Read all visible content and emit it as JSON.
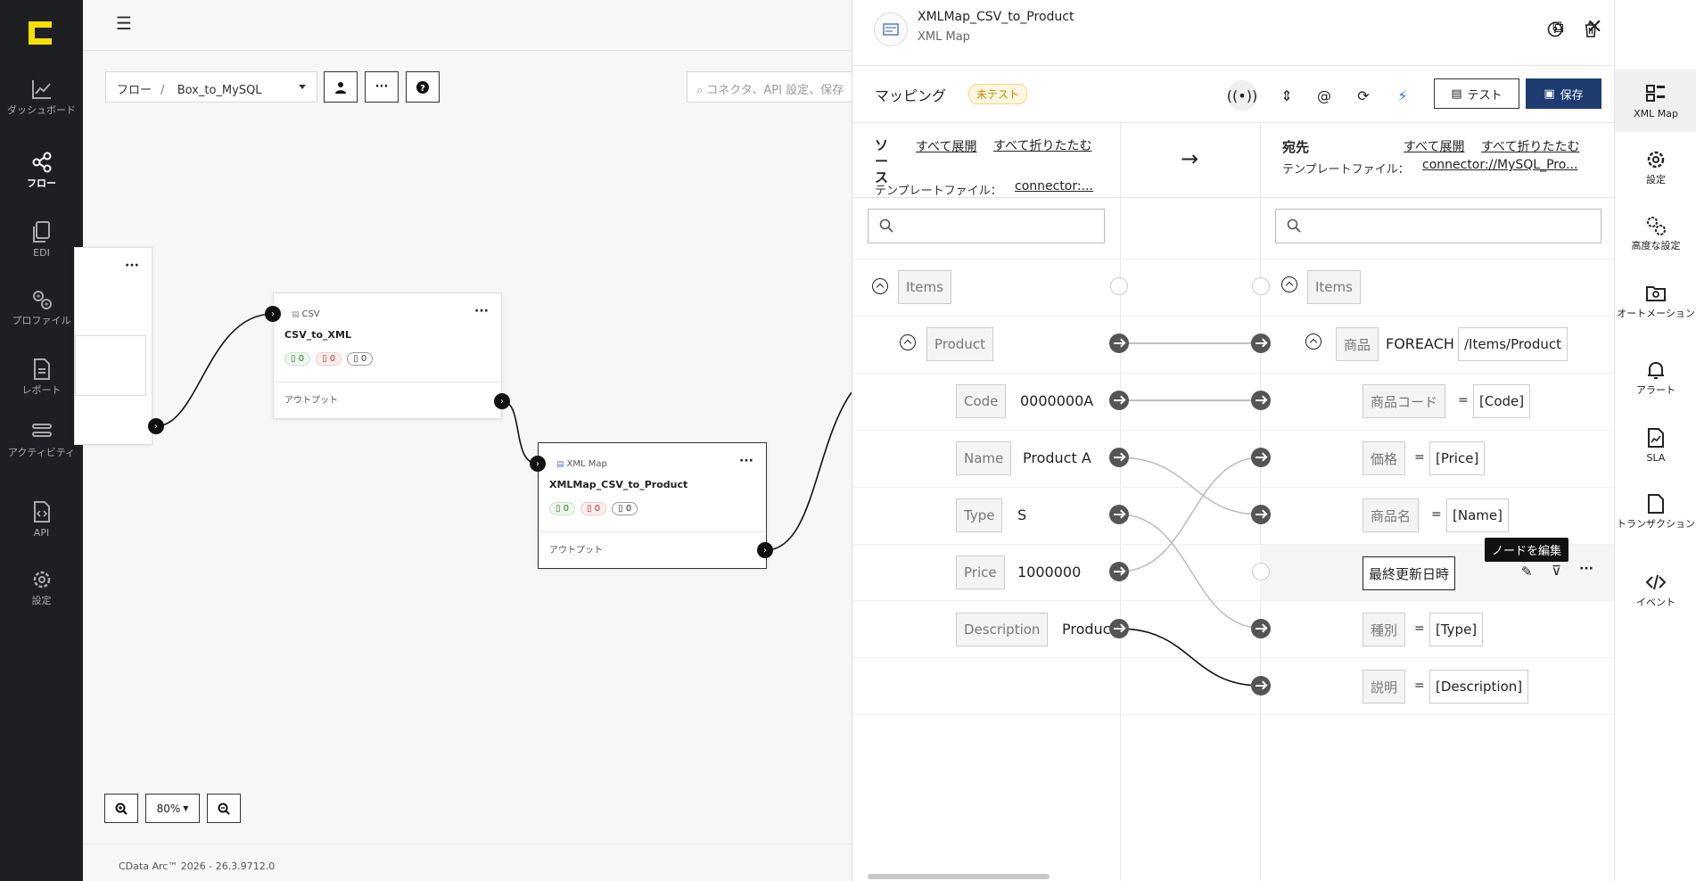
{
  "leftnav": {
    "items": [
      {
        "label": "ダッシュボード",
        "icon": "chart-line-icon"
      },
      {
        "label": "フロー",
        "icon": "share-nodes-icon"
      },
      {
        "label": "EDI",
        "icon": "copy-icon"
      },
      {
        "label": "プロファイル",
        "icon": "gears-icon"
      },
      {
        "label": "レポート",
        "icon": "file-lines-icon"
      },
      {
        "label": "アクティビティ",
        "icon": "layers-icon"
      },
      {
        "label": "API",
        "icon": "file-code-icon"
      },
      {
        "label": "設定",
        "icon": "gear-icon"
      }
    ]
  },
  "canvas": {
    "breadcrumb_root": "フロー",
    "breadcrumb_sep": "/",
    "breadcrumb_current": "Box_to_MySQL",
    "search_placeholder": "コネクタ、API 設定、保存",
    "zoom": "80%",
    "footer": "CData Arc™ 2026 - 26.3.9712.0",
    "nodes": [
      {
        "type": "CSV",
        "title": "CSV_to_XML",
        "ok": "0",
        "err": "0",
        "pending": "0",
        "out": "アウトプット"
      },
      {
        "type": "XML Map",
        "title": "XMLMap_CSV_to_Product",
        "ok": "0",
        "err": "0",
        "pending": "0",
        "out": "アウトプット"
      }
    ]
  },
  "panel": {
    "title": "XMLMap_CSV_to_Product",
    "subtitle": "XML Map",
    "tab_title": "マッピング",
    "badge": "未テスト",
    "test_label": "テスト",
    "save_label": "保存",
    "source": {
      "label": "ソース",
      "expand_all": "すべて展開",
      "collapse_all": "すべて折りたたむ",
      "template_label": "テンプレートファイル：",
      "template_value": "connector:..."
    },
    "arrow": "→",
    "dest": {
      "label": "宛先",
      "expand_all": "すべて展開",
      "collapse_all": "すべて折りたたむ",
      "template_label": "テンプレートファイル：",
      "template_value": "connector://MySQL_Pro..."
    },
    "source_rows": [
      {
        "name": "Items",
        "value": ""
      },
      {
        "name": "Product",
        "value": ""
      },
      {
        "name": "Code",
        "value": "0000000A"
      },
      {
        "name": "Name",
        "value": "Product A"
      },
      {
        "name": "Type",
        "value": "S"
      },
      {
        "name": "Price",
        "value": "1000000"
      },
      {
        "name": "Description",
        "value": "Produc"
      }
    ],
    "dest_rows": [
      {
        "name": "Items",
        "op": "",
        "expr": ""
      },
      {
        "name": "商品",
        "op": "FOREACH",
        "expr": "/Items/Product"
      },
      {
        "name": "商品コード",
        "op": "=",
        "expr": "[Code]"
      },
      {
        "name": "価格",
        "op": "=",
        "expr": "[Price]"
      },
      {
        "name": "商品名",
        "op": "=",
        "expr": "[Name]"
      },
      {
        "name": "最終更新日時",
        "op": "",
        "expr": ""
      },
      {
        "name": "種別",
        "op": "=",
        "expr": "[Type]"
      },
      {
        "name": "説明",
        "op": "=",
        "expr": "[Description]"
      }
    ],
    "tooltip": "ノードを編集"
  },
  "rail": {
    "items": [
      {
        "label": "XML Map",
        "icon": "grid-icon"
      },
      {
        "label": "設定",
        "icon": "gear-icon"
      },
      {
        "label": "高度な設定",
        "icon": "gears-icon"
      },
      {
        "label": "オートメーション",
        "icon": "folder-gear-icon"
      },
      {
        "label": "アラート",
        "icon": "bell-icon"
      },
      {
        "label": "SLA",
        "icon": "file-chart-icon"
      },
      {
        "label": "トランザクション",
        "icon": "file-icon"
      },
      {
        "label": "イベント",
        "icon": "code-icon"
      }
    ]
  },
  "colors": {
    "accent": "#1e3b70",
    "logo": "#f5e000",
    "nav_bg": "#1e1f22"
  }
}
